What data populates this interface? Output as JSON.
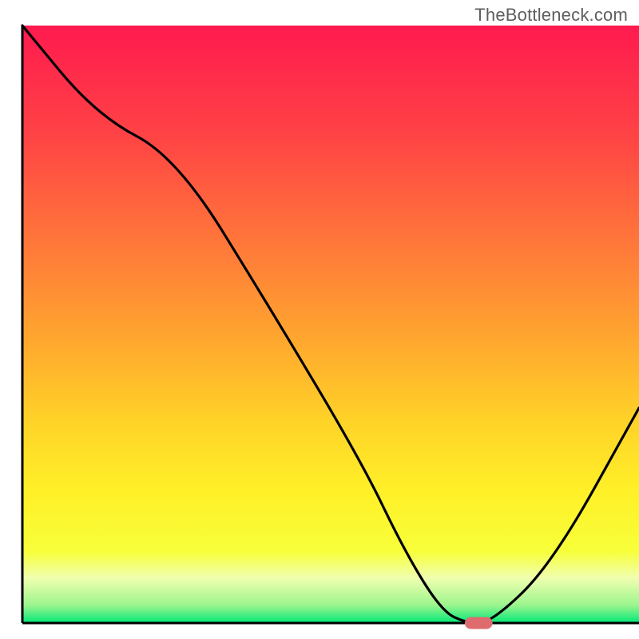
{
  "watermark": "TheBottleneck.com",
  "chart_data": {
    "type": "line",
    "title": "",
    "xlabel": "",
    "ylabel": "",
    "xlim": [
      0,
      100
    ],
    "ylim": [
      0,
      100
    ],
    "grid": false,
    "x": [
      0,
      12,
      25,
      40,
      55,
      62,
      68,
      72,
      76,
      86,
      100
    ],
    "values": [
      100,
      85,
      78,
      53,
      27,
      12,
      2,
      0,
      0,
      10,
      36
    ],
    "marker": {
      "x": 74,
      "y": 0,
      "w": 4.5,
      "h": 2,
      "color": "#de6c6f"
    },
    "gradient_stops": [
      {
        "offset": 0.0,
        "color": "#ff1a4f"
      },
      {
        "offset": 0.18,
        "color": "#ff4245"
      },
      {
        "offset": 0.36,
        "color": "#ff763a"
      },
      {
        "offset": 0.52,
        "color": "#ffa52f"
      },
      {
        "offset": 0.66,
        "color": "#ffd228"
      },
      {
        "offset": 0.78,
        "color": "#fff028"
      },
      {
        "offset": 0.88,
        "color": "#f7ff3a"
      },
      {
        "offset": 0.925,
        "color": "#f0ffb0"
      },
      {
        "offset": 0.97,
        "color": "#9cf58e"
      },
      {
        "offset": 1.0,
        "color": "#00e878"
      }
    ],
    "axes": {
      "width": 3,
      "color": "#000000",
      "left_x": 3.5,
      "bottom_y": 97.5,
      "top_y": 4,
      "right_x": 100
    }
  }
}
